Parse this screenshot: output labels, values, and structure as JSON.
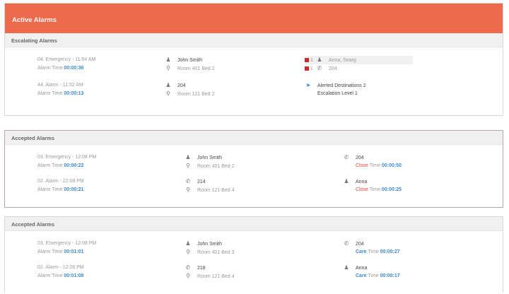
{
  "header": {
    "title": "Active Alarms"
  },
  "escalating": {
    "heading": "Escalating Alarms",
    "rows": [
      {
        "name": "04. Emergency - 11:54 AM",
        "time_label": "Alarm Time",
        "time": "00:00:36",
        "person": "John Smith",
        "location": "Room 401 Bed 2",
        "esc_line1_num": "1",
        "esc_line1_text": "Anna, Searg",
        "esc_line2_num": "1",
        "esc_line2_text": "204"
      },
      {
        "name": "44. Alarm - 11:52 AM",
        "time_label": "Alarm Time",
        "time": "00:00:13",
        "person": "204",
        "location": "Room 121 Bed 2",
        "esc_line1_text": "Alerted Destinations 2",
        "esc_line2_text": "Escalation Level 1"
      }
    ]
  },
  "accepted1": {
    "heading": "Accepted Alarms",
    "rows": [
      {
        "name": "03. Emergency - 12:08 PM",
        "time_label": "Alarm Time",
        "time": "00:00:22",
        "person": "John Smith",
        "location": "Room 401 Bed 2",
        "right_name": "204",
        "close_label": "Close",
        "close_time_label": "Time",
        "close_time": "00:00:50"
      },
      {
        "name": "02. Alarm - 12:08 PM",
        "time_label": "Alarm Time",
        "time": "00:00:21",
        "person": "214",
        "location": "Room 121 Bed 4",
        "right_name": "Anna",
        "close_label": "Close",
        "close_time_label": "Time",
        "close_time": "00:00:25"
      }
    ]
  },
  "accepted2": {
    "heading": "Accepted Alarms",
    "rows": [
      {
        "name": "03. Emergency - 12:08 PM",
        "time_label": "Alarm Time",
        "time": "00:01:01",
        "person": "John Smith",
        "location": "Room 401 Bed 3",
        "right_name": "204",
        "close_label": "Care",
        "close_time_label": "Time",
        "close_time": "00:00:27"
      },
      {
        "name": "02. Alarm - 12:08 PM",
        "time_label": "Alarm Time",
        "time": "00:01:08",
        "person": "218",
        "location": "Room 121 Bed 4",
        "right_name": "Anna",
        "close_label": "Care",
        "close_time_label": "Time",
        "close_time": "00:00:17"
      }
    ]
  },
  "colors": {
    "header": "#ee6a4c",
    "link_blue": "#3d8bd6",
    "alert_red": "#e64a3b",
    "marker_red": "#cc2a2a"
  },
  "icons": {
    "person": "person-badge-icon",
    "location": "map-pin-icon",
    "phone": "phone-icon",
    "arrow": "arrow-icon"
  }
}
